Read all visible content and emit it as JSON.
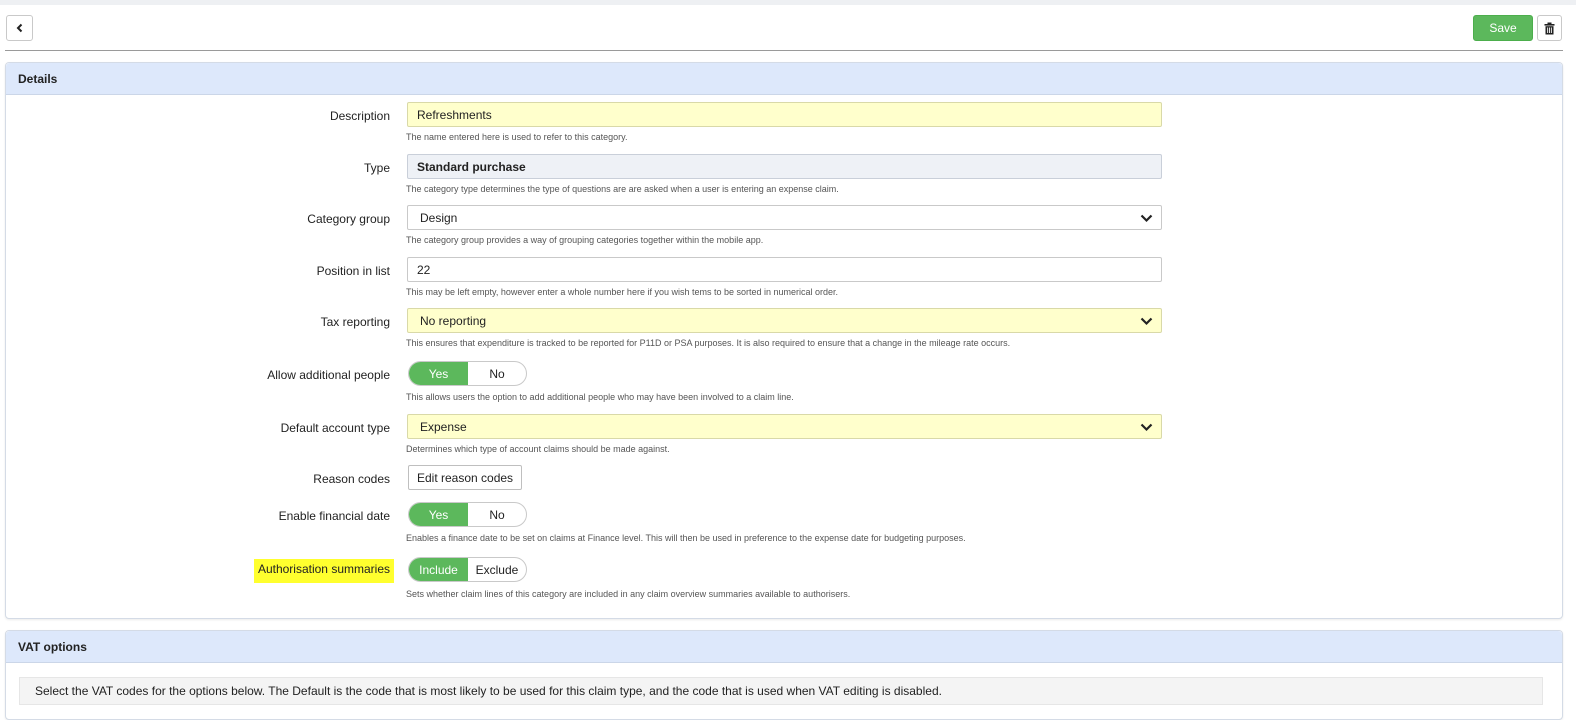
{
  "toolbar": {
    "save_label": "Save",
    "icons": {
      "back": "chevron-left-icon",
      "delete": "trash-icon"
    }
  },
  "colors": {
    "accent": "#5cb85c",
    "panel_header": "#dde8fb",
    "highlight": "#ffff2e",
    "field_yellow": "#ffffcc"
  },
  "details": {
    "title": "Details",
    "description": {
      "label": "Description",
      "value": "Refreshments",
      "help": "The name entered here is used to refer to this category."
    },
    "type": {
      "label": "Type",
      "value": "Standard purchase",
      "help": "The category type determines the type of questions are are asked when a user is entering an expense claim."
    },
    "category_group": {
      "label": "Category group",
      "value": "Design",
      "help": "The category group provides a way of grouping categories together within the mobile app."
    },
    "position": {
      "label": "Position in list",
      "value": "22",
      "help": "This may be left empty, however enter a whole number here if you wish tems to be sorted in numerical order."
    },
    "tax_reporting": {
      "label": "Tax reporting",
      "value": "No reporting",
      "help": "This ensures that expenditure is tracked to be reported for P11D or PSA purposes. It is also required to ensure that a change in the mileage rate occurs."
    },
    "allow_people": {
      "label": "Allow additional people",
      "yes": "Yes",
      "no": "No",
      "selected": "Yes",
      "help": "This allows users the option to add additional people who may have been involved to a claim line."
    },
    "account_type": {
      "label": "Default account type",
      "value": "Expense",
      "help": "Determines which type of account claims should be made against."
    },
    "reason_codes": {
      "label": "Reason codes",
      "button": "Edit reason codes"
    },
    "financial_date": {
      "label": "Enable financial date",
      "yes": "Yes",
      "no": "No",
      "selected": "Yes",
      "help": "Enables a finance date to be set on claims at Finance level. This will then be used in preference to the expense date for budgeting purposes."
    },
    "auth_summaries": {
      "label": "Authorisation summaries",
      "include": "Include",
      "exclude": "Exclude",
      "selected": "Include",
      "help": "Sets whether claim lines of this category are included in any claim overview summaries available to authorisers."
    }
  },
  "vat": {
    "title": "VAT options",
    "note": "Select the VAT codes for the options below. The Default is the code that is most likely to be used for this claim type, and the code that is used when VAT editing is disabled."
  }
}
